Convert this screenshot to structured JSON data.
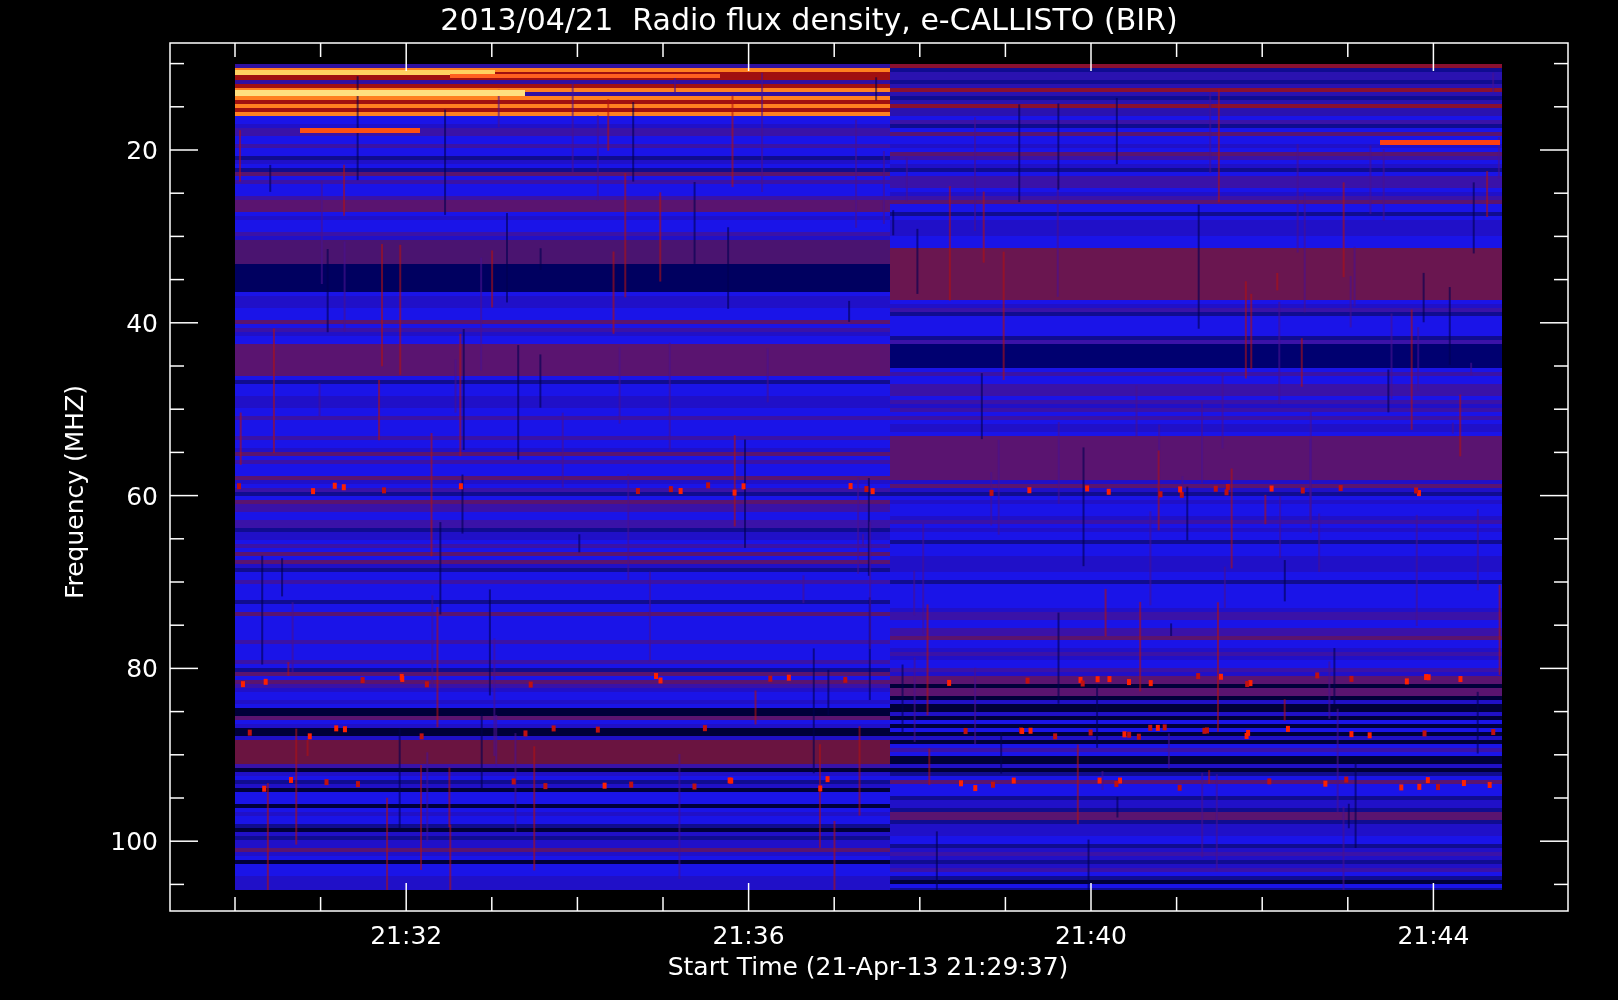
{
  "title": "2013/04/21  Radio flux density, e-CALLISTO (BIR)",
  "y_axis": {
    "label": "Frequency (MHZ)",
    "ticks": [
      "20",
      "40",
      "60",
      "80",
      "100"
    ]
  },
  "x_axis": {
    "label": "Start Time (21-Apr-13 21:29:37)",
    "ticks": [
      "21:32",
      "21:36",
      "21:40",
      "21:44"
    ]
  }
}
